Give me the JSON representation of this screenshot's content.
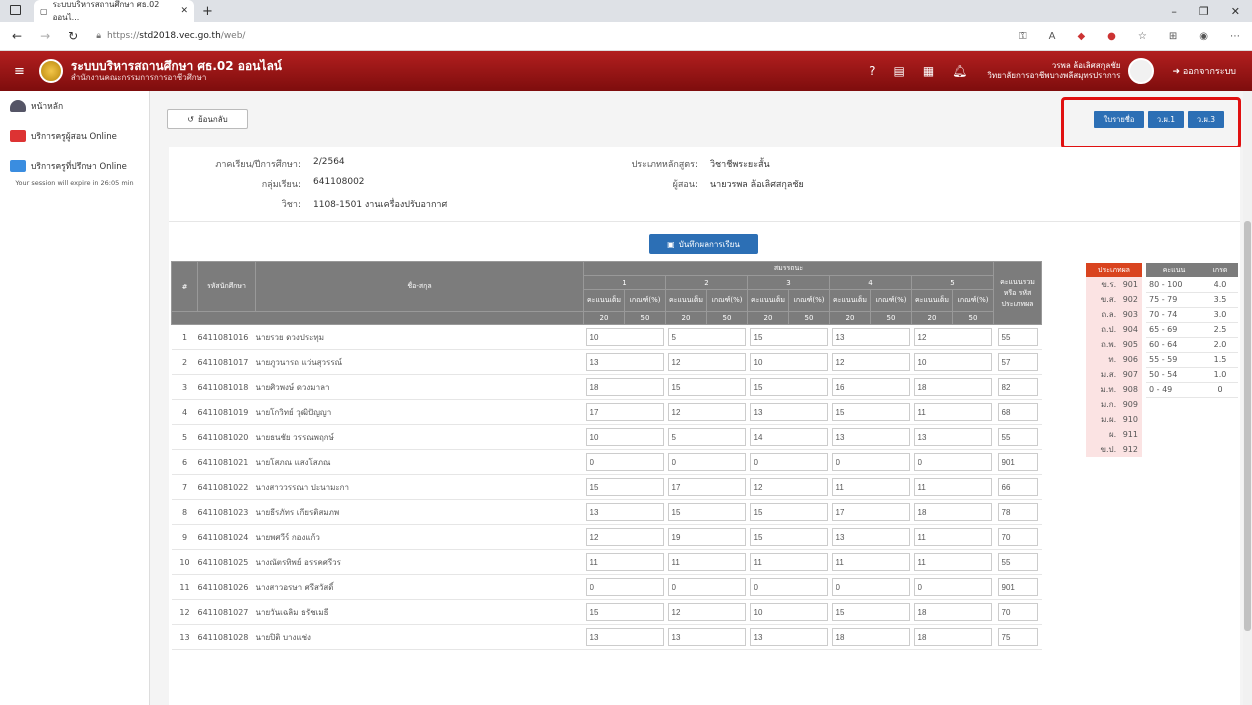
{
  "browser": {
    "tab_title": "ระบบบริหารสถานศึกษา ศธ.02 ออนไ...",
    "url_prefix": "https://",
    "url_host": "std2018.vec.go.th",
    "url_path": "/web/"
  },
  "header": {
    "title": "ระบบบริหารสถานศึกษา ศธ.02 ออนไลน์",
    "subtitle": "สำนักงานคณะกรรมการการอาชีวศึกษา",
    "user_name": "วรพล ล้อเลิศสกุลชัย",
    "user_college": "วิทยาลัยการอาชีพบางพลีสมุทรปราการ",
    "logout_label": "ออกจากระบบ"
  },
  "sidebar": {
    "items": [
      {
        "label": "หน้าหลัก"
      },
      {
        "label": "บริการครูผู้สอน Online"
      },
      {
        "label": "บริการครูที่ปรึกษา Online"
      }
    ],
    "session_text": "Your session will expire in 26:05 min"
  },
  "toolbar": {
    "back_label": "ย้อนกลับ",
    "btn_list": "ใบรายชื่อ",
    "btn_w1": "ว.ผ.1",
    "btn_w3": "ว.ผ.3",
    "save_label": "บันทึกผลการเรียน"
  },
  "info": {
    "semester_label": "ภาคเรียน/ปีการศึกษา:",
    "semester_value": "2/2564",
    "group_label": "กลุ่มเรียน:",
    "group_value": "641108002",
    "subject_label": "วิชา:",
    "subject_value": "1108-1501  งานเครื่องปรับอากาศ",
    "course_type_label": "ประเภทหลักสูตร:",
    "course_type_value": "วิชาชีพระยะสั้น",
    "teacher_label": "ผู้สอน:",
    "teacher_value": "นายวรพล ล้อเลิศสกุลชัย"
  },
  "table": {
    "col_no": "#",
    "col_id": "รหัสนักศึกษา",
    "col_name": "ชื่อ-สกุล",
    "col_competency": "สมรรถนะ",
    "units": [
      "1",
      "2",
      "3",
      "4",
      "5"
    ],
    "col_full": "คะแนนเต็ม",
    "col_crit": "เกณฑ์(%)",
    "full_score": "20",
    "crit_score": "50",
    "col_total": "คะแนนรวม หรือ รหัสประเภทผล",
    "rows": [
      {
        "no": "1",
        "id": "6411081016",
        "name": "นายรวย ดวงประทุม",
        "scores": [
          "10",
          "5",
          "15",
          "13",
          "12"
        ],
        "total": "55"
      },
      {
        "no": "2",
        "id": "6411081017",
        "name": "นายภูวนารถ แว่นสุวรรณ์",
        "scores": [
          "13",
          "12",
          "10",
          "12",
          "10"
        ],
        "total": "57"
      },
      {
        "no": "3",
        "id": "6411081018",
        "name": "นายศิวพงษ์ ดวงมาลา",
        "scores": [
          "18",
          "15",
          "15",
          "16",
          "18"
        ],
        "total": "82"
      },
      {
        "no": "4",
        "id": "6411081019",
        "name": "นายโกวิทย์ วุฒิปัญญา",
        "scores": [
          "17",
          "12",
          "13",
          "15",
          "11"
        ],
        "total": "68"
      },
      {
        "no": "5",
        "id": "6411081020",
        "name": "นายธนชัย วรรณพฤกษ์",
        "scores": [
          "10",
          "5",
          "14",
          "13",
          "13"
        ],
        "total": "55"
      },
      {
        "no": "6",
        "id": "6411081021",
        "name": "นายโสภณ แสงโสภณ",
        "scores": [
          "0",
          "0",
          "0",
          "0",
          "0"
        ],
        "total": "901"
      },
      {
        "no": "7",
        "id": "6411081022",
        "name": "นางสาววรรณา ปะนามะกา",
        "scores": [
          "15",
          "17",
          "12",
          "11",
          "11"
        ],
        "total": "66"
      },
      {
        "no": "8",
        "id": "6411081023",
        "name": "นายธีรภัทร เกียรติสมภพ",
        "scores": [
          "13",
          "15",
          "15",
          "17",
          "18"
        ],
        "total": "78"
      },
      {
        "no": "9",
        "id": "6411081024",
        "name": "นายพศวีร์ กองแก้ว",
        "scores": [
          "12",
          "19",
          "15",
          "13",
          "11"
        ],
        "total": "70"
      },
      {
        "no": "10",
        "id": "6411081025",
        "name": "นางณัตรทิพย์ อรรคศรีวร",
        "scores": [
          "11",
          "11",
          "11",
          "11",
          "11"
        ],
        "total": "55"
      },
      {
        "no": "11",
        "id": "6411081026",
        "name": "นางสาวอรษา ศรีสวัสดิ์",
        "scores": [
          "0",
          "0",
          "0",
          "0",
          "0"
        ],
        "total": "901"
      },
      {
        "no": "12",
        "id": "6411081027",
        "name": "นายวันเฉลิม ธรัชเมธี",
        "scores": [
          "15",
          "12",
          "10",
          "15",
          "18"
        ],
        "total": "70"
      },
      {
        "no": "13",
        "id": "6411081028",
        "name": "นายปิติ บางแช่ง",
        "scores": [
          "13",
          "13",
          "13",
          "18",
          "18"
        ],
        "total": "75"
      }
    ]
  },
  "result_types": {
    "header": "ประเภทผล",
    "rows": [
      {
        "label": "ข.ร.",
        "code": "901"
      },
      {
        "label": "ข.ส.",
        "code": "902"
      },
      {
        "label": "ถ.ล.",
        "code": "903"
      },
      {
        "label": "ถ.ป.",
        "code": "904"
      },
      {
        "label": "ถ.พ.",
        "code": "905"
      },
      {
        "label": "ท.",
        "code": "906"
      },
      {
        "label": "ม.ส.",
        "code": "907"
      },
      {
        "label": "ม.ท.",
        "code": "908"
      },
      {
        "label": "ม.ก.",
        "code": "909"
      },
      {
        "label": "ม.ผ.",
        "code": "910"
      },
      {
        "label": "ผ.",
        "code": "911"
      },
      {
        "label": "ข.ป.",
        "code": "912"
      }
    ]
  },
  "grades": {
    "header_score": "คะแนน",
    "header_grade": "เกรด",
    "rows": [
      {
        "range": "80 - 100",
        "grade": "4.0"
      },
      {
        "range": "75 - 79",
        "grade": "3.5"
      },
      {
        "range": "70 - 74",
        "grade": "3.0"
      },
      {
        "range": "65 - 69",
        "grade": "2.5"
      },
      {
        "range": "60 - 64",
        "grade": "2.0"
      },
      {
        "range": "55 - 59",
        "grade": "1.5"
      },
      {
        "range": "50 - 54",
        "grade": "1.0"
      },
      {
        "range": "0 - 49",
        "grade": "0"
      }
    ]
  }
}
